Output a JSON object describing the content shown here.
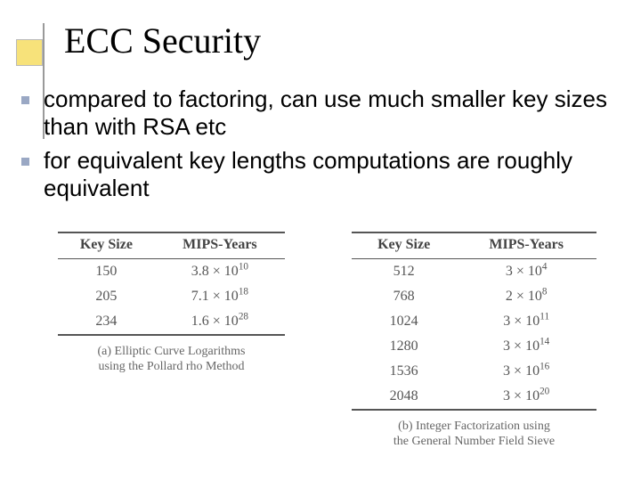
{
  "title": "ECC Security",
  "bullets": [
    "compared to factoring, can use much smaller key sizes than with RSA etc",
    "for equivalent key lengths computations are roughly equivalent"
  ],
  "table_a": {
    "headers": [
      "Key Size",
      "MIPS-Years"
    ],
    "rows": [
      {
        "key": "150",
        "coef": "3.8",
        "exp": "10"
      },
      {
        "key": "205",
        "coef": "7.1",
        "exp": "18"
      },
      {
        "key": "234",
        "coef": "1.6",
        "exp": "28"
      }
    ],
    "caption_l1": "(a) Elliptic Curve Logarithms",
    "caption_l2": "using the Pollard rho Method"
  },
  "table_b": {
    "headers": [
      "Key Size",
      "MIPS-Years"
    ],
    "rows": [
      {
        "key": "512",
        "coef": "3",
        "exp": "4"
      },
      {
        "key": "768",
        "coef": "2",
        "exp": "8"
      },
      {
        "key": "1024",
        "coef": "3",
        "exp": "11"
      },
      {
        "key": "1280",
        "coef": "3",
        "exp": "14"
      },
      {
        "key": "1536",
        "coef": "3",
        "exp": "16"
      },
      {
        "key": "2048",
        "coef": "3",
        "exp": "20"
      }
    ],
    "caption_l1": "(b) Integer Factorization using",
    "caption_l2": "the General Number Field Sieve"
  },
  "chart_data": [
    {
      "type": "table",
      "title": "(a) Elliptic Curve Logarithms using the Pollard rho Method",
      "columns": [
        "Key Size",
        "MIPS-Years"
      ],
      "rows": [
        [
          150,
          38000000000.0
        ],
        [
          205,
          7.1e+18
        ],
        [
          234,
          1.6e+28
        ]
      ]
    },
    {
      "type": "table",
      "title": "(b) Integer Factorization using the General Number Field Sieve",
      "columns": [
        "Key Size",
        "MIPS-Years"
      ],
      "rows": [
        [
          512,
          30000.0
        ],
        [
          768,
          200000000.0
        ],
        [
          1024,
          300000000000.0
        ],
        [
          1280,
          300000000000000.0
        ],
        [
          1536,
          3e+16
        ],
        [
          2048,
          3e+20
        ]
      ]
    }
  ]
}
